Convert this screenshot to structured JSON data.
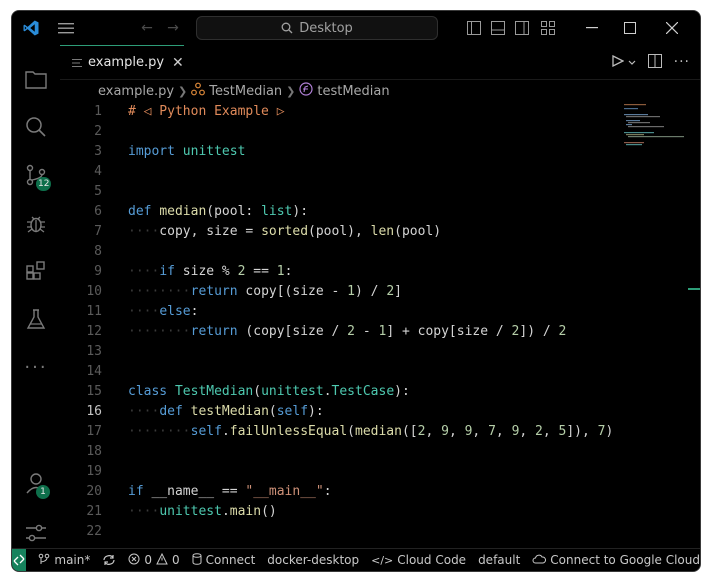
{
  "titlebar": {
    "search_placeholder": "Desktop",
    "search_icon": "search-icon",
    "nav_back_icon": "arrow-left-icon",
    "nav_forward_icon": "arrow-right-icon"
  },
  "activity_bar": {
    "items": [
      {
        "name": "explorer",
        "icon": "files-icon"
      },
      {
        "name": "search",
        "icon": "search-icon"
      },
      {
        "name": "source-control",
        "icon": "source-control-icon",
        "badge": "12"
      },
      {
        "name": "run-debug",
        "icon": "bug-icon"
      },
      {
        "name": "extensions",
        "icon": "extensions-icon"
      },
      {
        "name": "testing",
        "icon": "beaker-icon"
      },
      {
        "name": "more",
        "icon": "ellipsis-icon"
      }
    ],
    "bottom": [
      {
        "name": "accounts",
        "icon": "account-icon",
        "badge": "1"
      },
      {
        "name": "manage",
        "icon": "settings-sliders-icon"
      }
    ]
  },
  "tab": {
    "label": "example.py"
  },
  "breadcrumbs": {
    "file": "example.py",
    "class": "TestMedian",
    "method": "testMedian"
  },
  "editor": {
    "active_line": 16,
    "lines": [
      {
        "n": "1",
        "html": "<span class=\"cm\"># ◁ Python Example ▷</span>"
      },
      {
        "n": "2",
        "html": ""
      },
      {
        "n": "3",
        "html": "<span class=\"kw\">import</span> <span class=\"cls\">unittest</span>"
      },
      {
        "n": "4",
        "html": ""
      },
      {
        "n": "5",
        "html": ""
      },
      {
        "n": "6",
        "html": "<span class=\"kw\">def</span> <span class=\"fn\">median</span>(pool: <span class=\"cls\">list</span>):"
      },
      {
        "n": "7",
        "html": "    copy, size = <span class=\"fn\">sorted</span>(pool), <span class=\"fn\">len</span>(pool)"
      },
      {
        "n": "8",
        "html": ""
      },
      {
        "n": "9",
        "html": "    <span class=\"kw\">if</span> size % <span class=\"num\">2</span> == <span class=\"num\">1</span>:"
      },
      {
        "n": "10",
        "html": "        <span class=\"kw\">return</span> copy[(size - <span class=\"num\">1</span>) / <span class=\"num\">2</span>]"
      },
      {
        "n": "11",
        "html": "    <span class=\"kw\">else</span>:"
      },
      {
        "n": "12",
        "html": "        <span class=\"kw\">return</span> (copy[size / <span class=\"num\">2</span> - <span class=\"num\">1</span>] + copy[size / <span class=\"num\">2</span>]) / <span class=\"num\">2</span>"
      },
      {
        "n": "13",
        "html": ""
      },
      {
        "n": "14",
        "html": ""
      },
      {
        "n": "15",
        "html": "<span class=\"kw\">class</span> <span class=\"cls\">TestMedian</span>(<span class=\"cls\">unittest</span>.<span class=\"cls\">TestCase</span>):"
      },
      {
        "n": "16",
        "html": "    <span class=\"kw\">def</span> <span class=\"fn\">testMedian</span>(<span class=\"self\">self</span>):"
      },
      {
        "n": "17",
        "html": "        <span class=\"self\">self</span>.<span class=\"fn\">failUnlessEqual</span>(<span class=\"fn\">median</span>([<span class=\"num\">2</span>, <span class=\"num\">9</span>, <span class=\"num\">9</span>, <span class=\"num\">7</span>, <span class=\"num\">9</span>, <span class=\"num\">2</span>, <span class=\"num\">5</span>]), <span class=\"num\">7</span>)"
      },
      {
        "n": "18",
        "html": ""
      },
      {
        "n": "19",
        "html": ""
      },
      {
        "n": "20",
        "html": "<span class=\"kw\">if</span> __name__ == <span class=\"str\">\"__main__\"</span>:"
      },
      {
        "n": "21",
        "html": "    <span class=\"cls\">unittest</span>.<span class=\"fn\">main</span>()"
      },
      {
        "n": "22",
        "html": ""
      }
    ]
  },
  "statusbar": {
    "branch": "main*",
    "errors": "0",
    "warnings": "0",
    "connect": "Connect",
    "docker": "docker-desktop",
    "cloud_code": "Cloud Code",
    "default": "default",
    "google_cloud": "Connect to Google Cloud"
  },
  "colors": {
    "accent": "#2d9d78",
    "badge": "#0e6f4b",
    "logo": "#2a8cd8"
  }
}
